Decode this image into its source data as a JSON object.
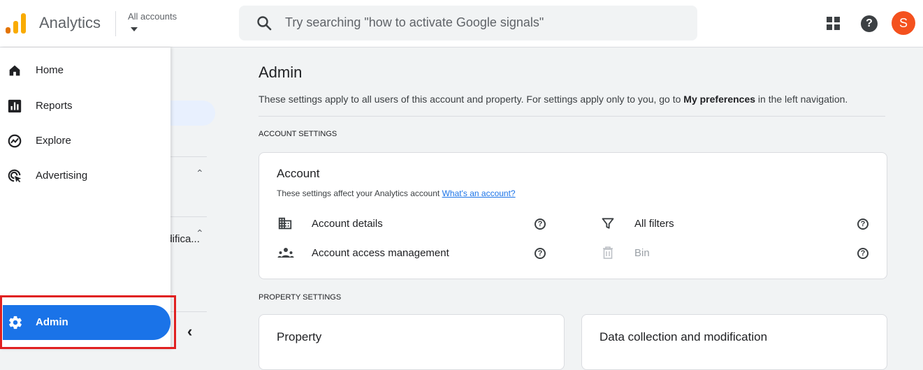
{
  "header": {
    "brand": "Analytics",
    "account_label": "All accounts",
    "search_placeholder": "Try searching \"how to activate Google signals\"",
    "avatar_letter": "S"
  },
  "colors": {
    "accent": "#1a73e8",
    "highlight_border": "#e02020",
    "avatar": "#f4511e",
    "logo_orange": "#f9ab00",
    "logo_dark_orange": "#e37400"
  },
  "sidenav": {
    "items": [
      {
        "label": "Home",
        "icon": "home-icon"
      },
      {
        "label": "Reports",
        "icon": "bar-chart-icon"
      },
      {
        "label": "Explore",
        "icon": "explore-icon"
      },
      {
        "label": "Advertising",
        "icon": "advertising-icon"
      }
    ],
    "admin": {
      "label": "Admin",
      "icon": "gear-icon"
    }
  },
  "subnav": {
    "truncated_item": "odifica..."
  },
  "main": {
    "title": "Admin",
    "subtitle_start": "These settings apply to all users of this account and property. For settings apply only to you, go to ",
    "subtitle_bold": "My preferences",
    "subtitle_end": " in the left navigation.",
    "account_section_label": "ACCOUNT SETTINGS",
    "property_section_label": "PROPERTY SETTINGS",
    "account_card": {
      "title": "Account",
      "desc": "These settings affect your Analytics account ",
      "desc_link": "What's an account?",
      "rows": [
        {
          "label": "Account details",
          "icon": "building-icon"
        },
        {
          "label": "Account access management",
          "icon": "people-icon"
        },
        {
          "label": "All filters",
          "icon": "filter-icon"
        },
        {
          "label": "Bin",
          "icon": "trash-icon"
        }
      ]
    },
    "property_card": {
      "title": "Property"
    },
    "data_card": {
      "title": "Data collection and modification"
    }
  }
}
